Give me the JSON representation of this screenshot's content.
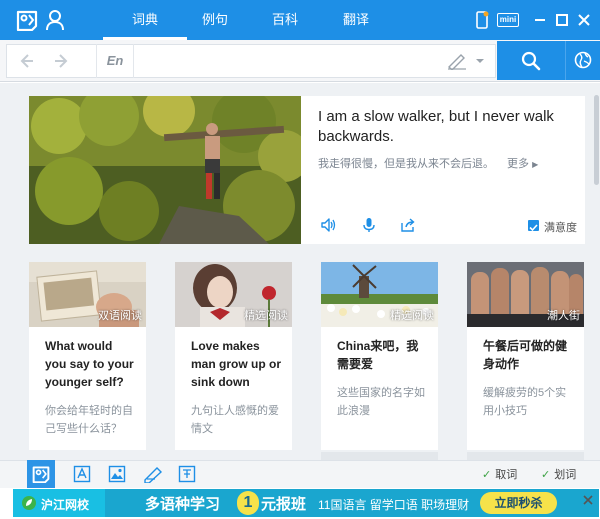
{
  "header": {
    "tabs": [
      {
        "label": "词典",
        "active": true
      },
      {
        "label": "例句",
        "active": false
      },
      {
        "label": "百科",
        "active": false
      },
      {
        "label": "翻译",
        "active": false
      }
    ],
    "mini_label": "mini",
    "accent_color": "#1e8fe6"
  },
  "search": {
    "lang_label": "En",
    "value": "",
    "placeholder": ""
  },
  "hero": {
    "english": "I am a slow walker, but I never walk backwards.",
    "chinese": "我走得很慢，但是我从来不会后退。",
    "more_label": "更多",
    "satisfaction_label": "满意度",
    "satisfaction_checked": true
  },
  "cards": [
    {
      "badge": "双语阅读",
      "title": "What would you say to your younger self?",
      "desc": "你会给年轻时的自己写些什么话？"
    },
    {
      "badge": "精选阅读",
      "title": "Love makes man grow up or sink down",
      "desc": "九句让人感慨的爱情文"
    },
    {
      "badge": "精选阅读",
      "title": "China来吧，我需要爱",
      "desc": "这些国家的名字如此浪漫"
    },
    {
      "badge": "潮人街",
      "title": "午餐后可做的健身动作",
      "desc": "缓解疲劳的5个实用小技巧"
    }
  ],
  "toolbar": {
    "toggle_quci": "取词",
    "toggle_huaci": "划词"
  },
  "ad": {
    "brand": "沪江网校",
    "main_text_1": "多语种学习",
    "main_num": "1",
    "main_text_2": "元报班",
    "sub_text": "11国语言 留学口语 职场理财",
    "cta": "立即秒杀"
  }
}
